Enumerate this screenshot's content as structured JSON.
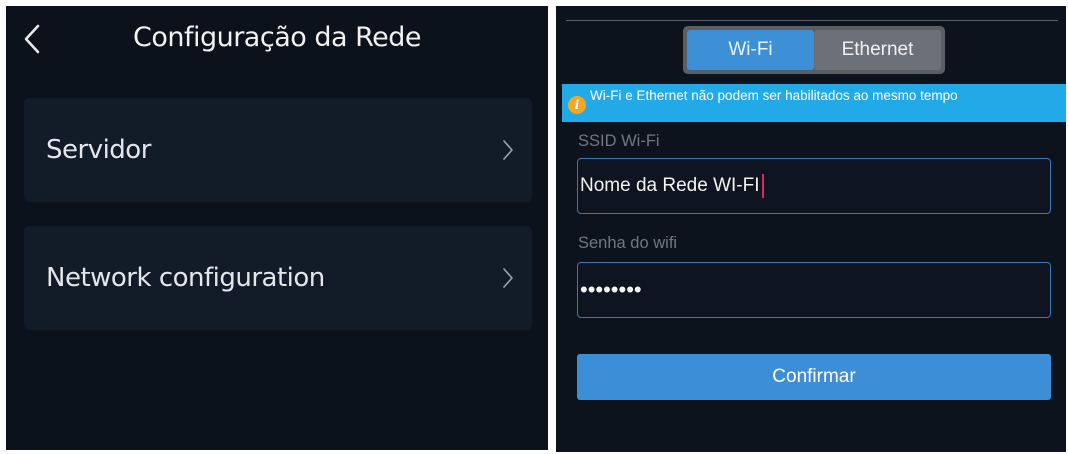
{
  "left_screen": {
    "title": "Configuração da Rede",
    "items": [
      {
        "label": "Servidor"
      },
      {
        "label": "Network configuration"
      }
    ]
  },
  "right_screen": {
    "tabs": {
      "wifi": "Wi-Fi",
      "ethernet": "Ethernet",
      "selected": "Wi-Fi"
    },
    "notice": "Wi-Fi e Ethernet não podem ser habilitados ao mesmo tempo",
    "ssid": {
      "label": "SSID Wi-Fi",
      "value": "Nome da Rede WI-FI"
    },
    "password": {
      "label": "Senha do wifi",
      "value": "••••••••"
    },
    "confirm_label": "Confirmar"
  },
  "icons": {
    "back": "chevron-left-icon",
    "chevron": "chevron-right-icon",
    "info": "info-icon"
  },
  "colors": {
    "background": "#0c121c",
    "card": "#121c29",
    "accent": "#3d8fd6",
    "notice": "#22a9e8",
    "info_icon": "#f5a623",
    "field_border": "#3a79b8",
    "caret": "#e0245e"
  }
}
